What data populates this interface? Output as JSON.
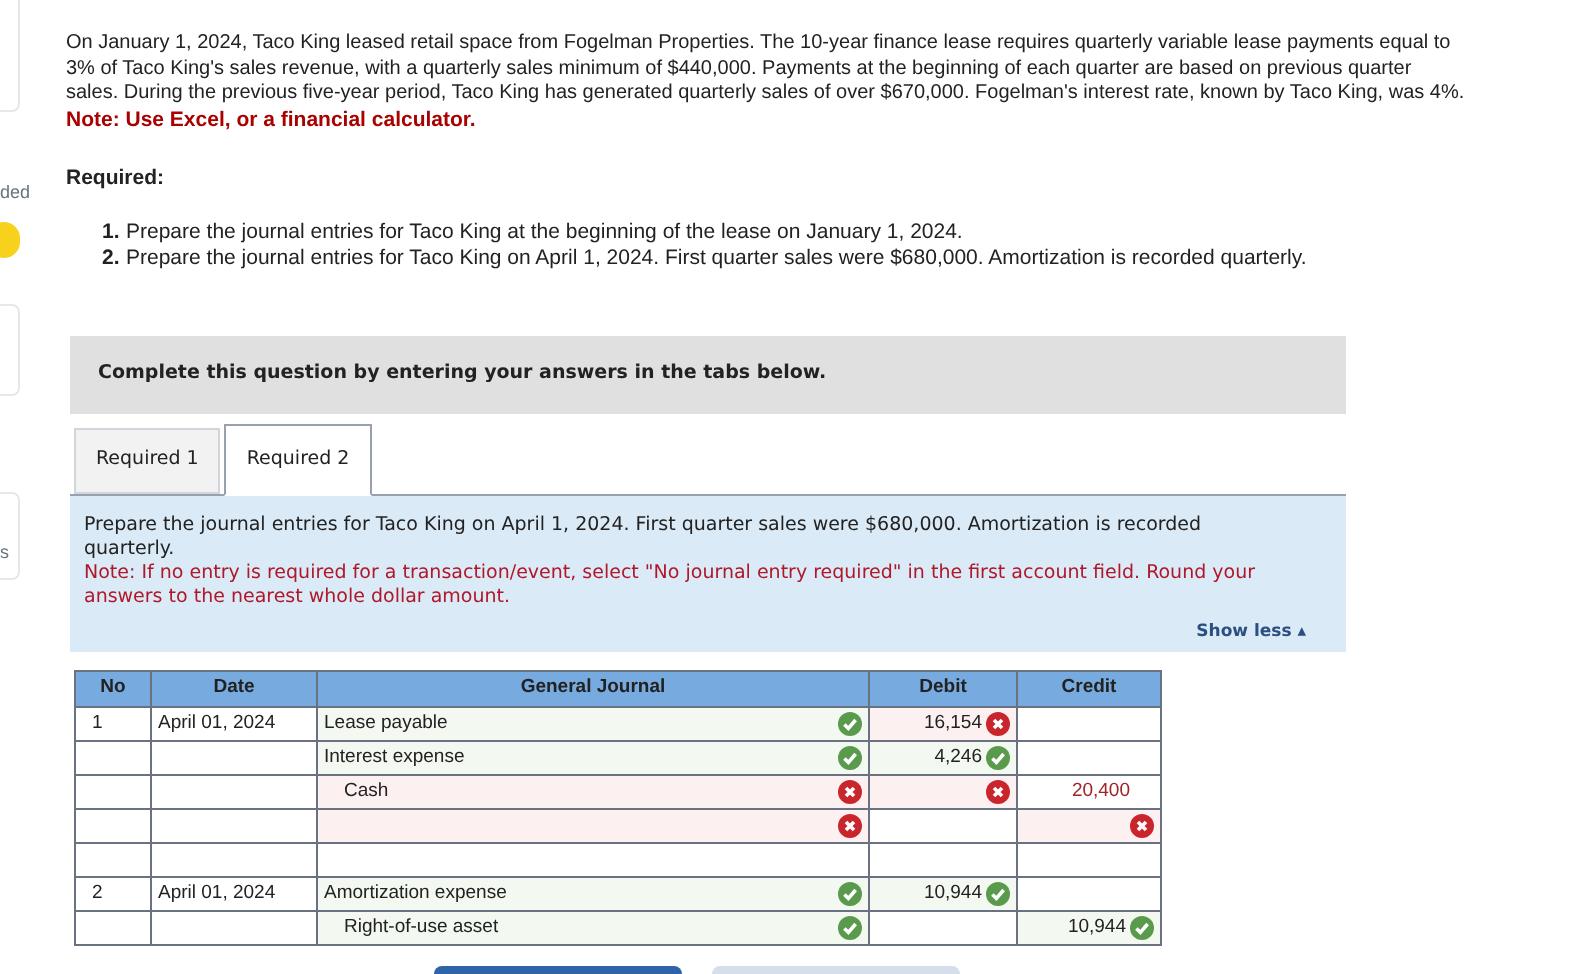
{
  "sidebar": {
    "labels": [
      "ded",
      "s"
    ]
  },
  "problem": {
    "text": "On January 1, 2024, Taco King leased retail space from Fogelman Properties. The 10-year finance lease requires quarterly variable lease payments equal to 3% of Taco King's sales revenue, with a quarterly sales minimum of $440,000. Payments at the beginning of each quarter are based on previous quarter sales. During the previous five-year period, Taco King has generated quarterly sales of over $670,000. Fogelman's interest rate, known by Taco King, was 4%.",
    "note": "Note: Use Excel, or a financial calculator."
  },
  "required": {
    "heading": "Required:",
    "items": [
      {
        "number": "1.",
        "text": "Prepare the journal entries for Taco King at the beginning of the lease on January 1, 2024."
      },
      {
        "number": "2.",
        "text": "Prepare the journal entries for Taco King on April 1, 2024. First quarter sales were $680,000. Amortization is recorded quarterly."
      }
    ]
  },
  "instructions": "Complete this question by entering your answers in the tabs below.",
  "tabs": [
    {
      "label": "Required 1",
      "selected": false
    },
    {
      "label": "Required 2",
      "selected": true
    }
  ],
  "panel": {
    "text": "Prepare the journal entries for Taco King on April 1, 2024. First quarter sales were $680,000. Amortization is recorded quarterly.",
    "note": "Note: If no entry is required for a transaction/event, select \"No journal entry required\" in the first account field. Round your answers to the nearest whole dollar amount.",
    "toggle": "Show less ▴"
  },
  "journal": {
    "columns": [
      "No",
      "Date",
      "General Journal",
      "Debit",
      "Credit"
    ],
    "rows": [
      {
        "no": "1",
        "date": "April 01, 2024",
        "account": "Lease payable",
        "credited": false,
        "account_correct": true,
        "debit": "16,154",
        "debit_correct": false
      },
      {
        "account": "Interest expense",
        "credited": false,
        "account_correct": true,
        "debit": "4,246",
        "debit_correct": true
      },
      {
        "account": "Cash",
        "credited": true,
        "account_correct": false,
        "debit_correct": false,
        "credit": "20,400",
        "credit_error": true
      },
      {
        "account_correct": false,
        "credit_correct": false
      },
      {},
      {
        "no": "2",
        "date": "April 01, 2024",
        "account": "Amortization expense",
        "credited": false,
        "account_correct": true,
        "debit": "10,944",
        "debit_correct": true
      },
      {
        "account": "Right-of-use asset",
        "credited": true,
        "account_correct": true,
        "credit": "10,944",
        "credit_correct": true
      }
    ]
  }
}
